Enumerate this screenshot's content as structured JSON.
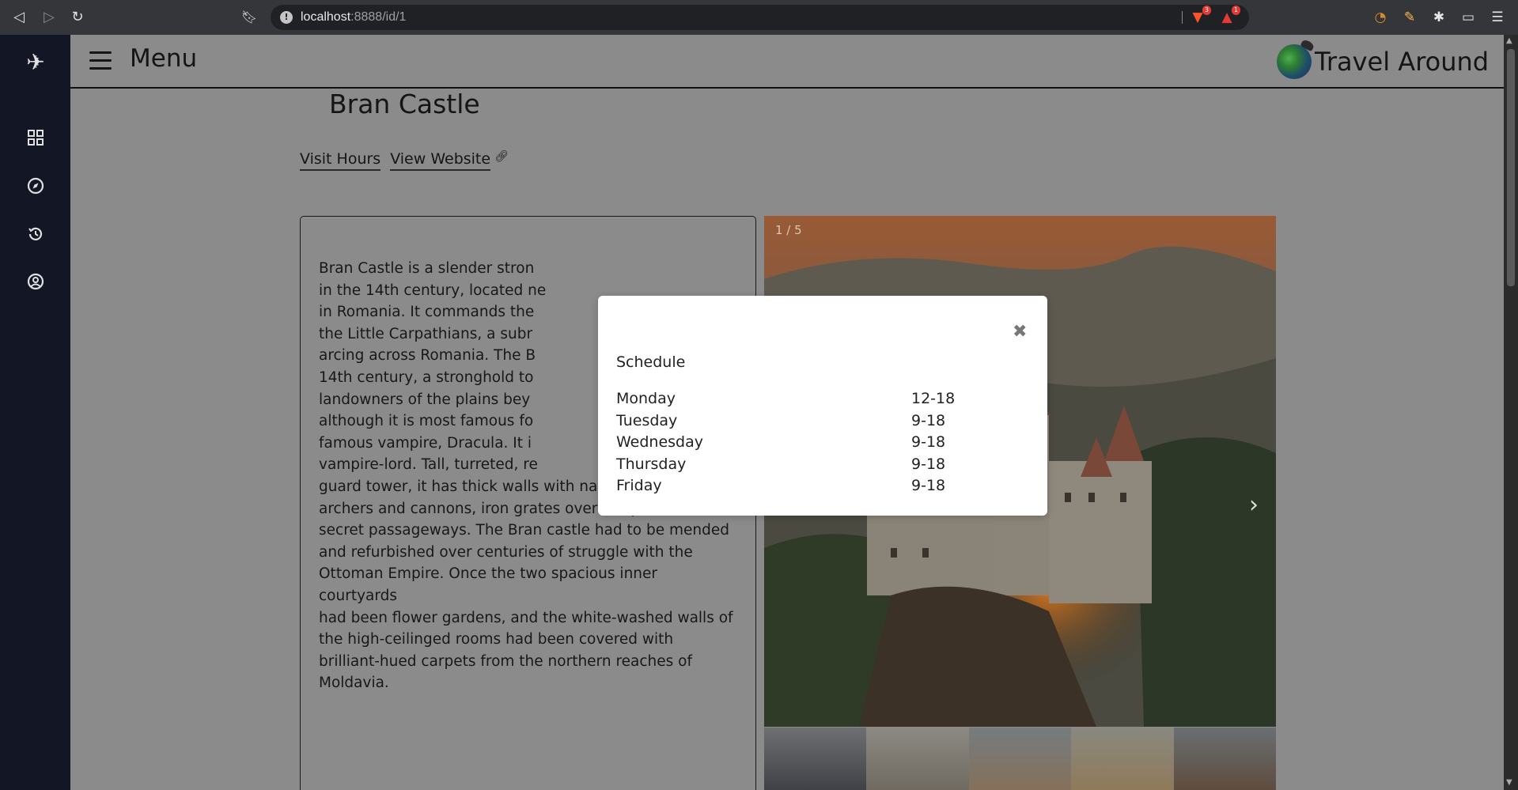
{
  "browser": {
    "url_host": "localhost",
    "url_path": ":8888/id/1",
    "brave_badge": "3",
    "alert_badge": "1"
  },
  "header": {
    "menu_label": "Menu",
    "brand": "Travel Around"
  },
  "page": {
    "title": "Bran Castle",
    "links": {
      "visit_hours": "Visit Hours",
      "view_website": "View Website"
    },
    "description_lines": [
      "Bran Castle is a slender stron",
      "in the 14th century, located ne",
      "in Romania. It commands the",
      "the Little Carpathians, a subr",
      "arcing across Romania. The B",
      "14th century, a stronghold to",
      "landowners of the plains bey",
      "although it is most famous fo",
      "famous vampire, Dracula. It i",
      "vampire-lord. Tall, turreted, re",
      "guard tower, it has thick walls with narrow openings for",
      "archers and cannons, iron grates over the portals, and",
      "secret passageways. The Bran castle had to be mended",
      "and refurbished over centuries of struggle with the",
      "Ottoman Empire. Once the two spacious inner courtyards",
      "had been flower gardens, and the white-washed walls of",
      "the high-ceilinged rooms had been covered with",
      "brilliant-hued carpets from the northern reaches of",
      "Moldavia."
    ]
  },
  "gallery": {
    "counter": "1 / 5",
    "prev": "‹",
    "next": "›"
  },
  "modal": {
    "close": "✖",
    "title": "Schedule",
    "rows": [
      {
        "day": "Monday",
        "hours": "12-18"
      },
      {
        "day": "Tuesday",
        "hours": "9-18"
      },
      {
        "day": "Wednesday",
        "hours": "9-18"
      },
      {
        "day": "Thursday",
        "hours": "9-18"
      },
      {
        "day": "Friday",
        "hours": "9-18"
      }
    ]
  },
  "colors": {
    "sidebar": "#121625",
    "overlay_bg": "#8b8b8b"
  }
}
